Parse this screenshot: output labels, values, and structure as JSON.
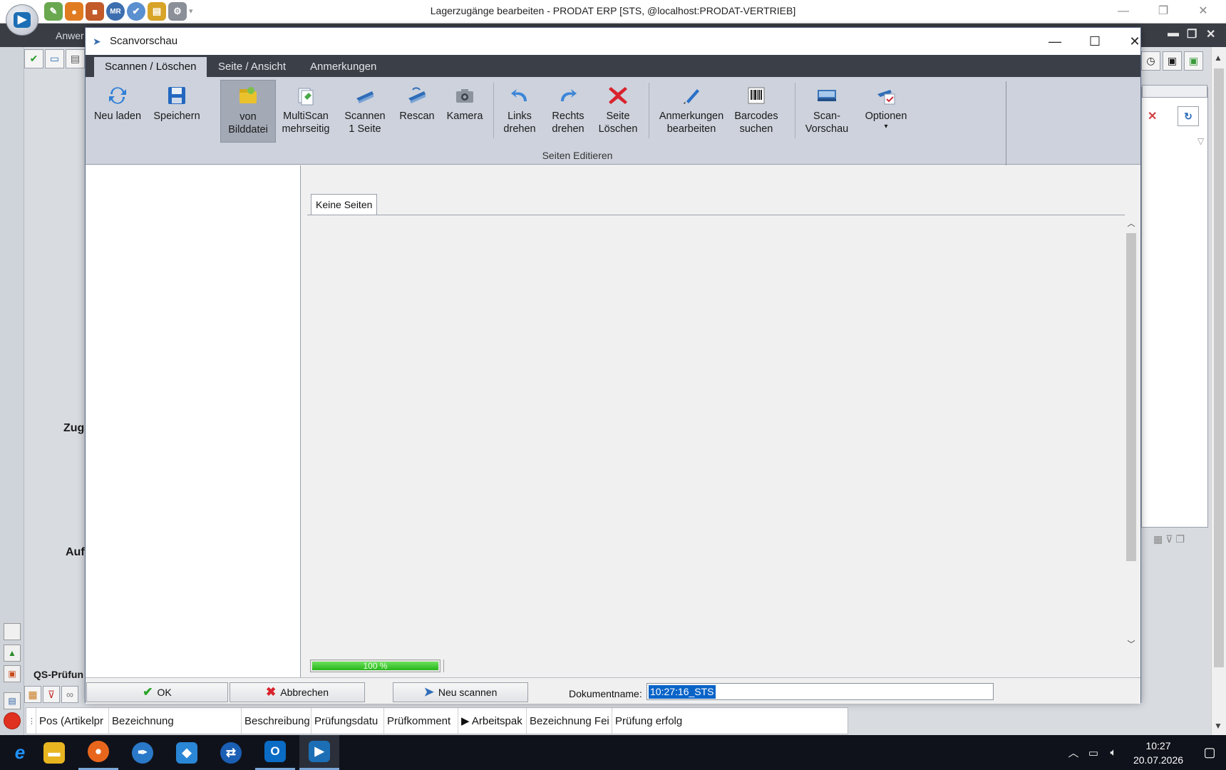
{
  "erp": {
    "window_title": "Lagerzugänge bearbeiten - PRODAT ERP   [STS,  @localhost:PRODAT-VERTRIEB]",
    "logo_glyph": "▶",
    "menu_partial": "Anwer",
    "quick_tools": [
      {
        "icon": "pencil-tool-icon",
        "glyph": "✎",
        "color": "#6aa84f"
      },
      {
        "icon": "orange-tool-icon",
        "glyph": "●",
        "color": "#e07b20"
      },
      {
        "icon": "boxes-tool-icon",
        "glyph": "■",
        "color": "#c25a2a"
      },
      {
        "icon": "mr-badge-icon",
        "glyph": "MR",
        "color": "#3d6fb0"
      },
      {
        "icon": "checkmark-circle-icon",
        "glyph": "✔",
        "color": "#5a8fd0"
      },
      {
        "icon": "book-tool-icon",
        "glyph": "▤",
        "color": "#d8a428"
      },
      {
        "icon": "gears-tool-icon",
        "glyph": "⚙",
        "color": "#8a8f98"
      }
    ],
    "background_labels": {
      "zug": "Zug",
      "auf": "Auf"
    },
    "qs_header": "QS-Prüfun",
    "qs_columns": [
      "Pos (Artikelpr",
      "Bezeichnung",
      "Beschreibung",
      "Prüfungsdatu",
      "Prüfkomment",
      "▶ Arbeitspak",
      "Bezeichnung Fei",
      "Prüfung erfolg"
    ]
  },
  "dialog": {
    "title": "Scanvorschau",
    "tabs": [
      "Scannen / Löschen",
      "Seite / Ansicht",
      "Anmerkungen"
    ],
    "ribbon_buttons": [
      {
        "line1": "Neu laden",
        "line2": "",
        "icon": "refresh-icon"
      },
      {
        "line1": "Speichern",
        "line2": "",
        "icon": "save-disk-icon"
      },
      {
        "line1": "von",
        "line2": "Bilddatei",
        "icon": "image-folder-icon"
      },
      {
        "line1": "MultiScan",
        "line2": "mehrseitig",
        "icon": "multiscan-icon"
      },
      {
        "line1": "Scannen",
        "line2": "1 Seite",
        "icon": "scanner-icon"
      },
      {
        "line1": "Rescan",
        "line2": "",
        "icon": "rescan-icon"
      },
      {
        "line1": "Kamera",
        "line2": "",
        "icon": "camera-icon"
      },
      {
        "line1": "Links",
        "line2": "drehen",
        "icon": "rotate-left-icon"
      },
      {
        "line1": "Rechts",
        "line2": "drehen",
        "icon": "rotate-right-icon"
      },
      {
        "line1": "Seite",
        "line2": "Löschen",
        "icon": "delete-page-icon"
      },
      {
        "line1": "Anmerkungen",
        "line2": "bearbeiten",
        "icon": "pen-icon"
      },
      {
        "line1": "Barcodes",
        "line2": "suchen",
        "icon": "barcode-icon"
      },
      {
        "line1": "Scan-",
        "line2": "Vorschau",
        "icon": "scan-preview-icon"
      },
      {
        "line1": "Optionen",
        "line2": "▾",
        "icon": "options-icon"
      }
    ],
    "group_label": "Seiten Editieren",
    "pages_tab": "Keine Seiten",
    "progress": {
      "value": 1.0,
      "label": "100 %"
    },
    "footer": {
      "ok_label": "OK",
      "cancel_label": "Abbrechen",
      "rescan_label": "Neu scannen",
      "docname_label": "Dokumentname:",
      "docname_value": "10:27:16_STS"
    }
  },
  "taskbar": {
    "apps": [
      {
        "icon": "internet-explorer-icon",
        "glyph": "e",
        "color": "#1e90ff"
      },
      {
        "icon": "file-explorer-icon",
        "glyph": "▬",
        "color": "#e8b520"
      },
      {
        "icon": "firefox-icon",
        "glyph": "●",
        "color": "#e8661c"
      },
      {
        "icon": "feather-app-icon",
        "glyph": "✒",
        "color": "#2a79c9"
      },
      {
        "icon": "vscode-icon",
        "glyph": "◆",
        "color": "#2a86d6"
      },
      {
        "icon": "teamviewer-icon",
        "glyph": "⇄",
        "color": "#1a5fb4"
      },
      {
        "icon": "outlook-icon",
        "glyph": "O",
        "color": "#0a6cc4"
      },
      {
        "icon": "prodat-erp-icon",
        "glyph": "▶",
        "color": "#1c6fb5"
      }
    ],
    "time": "10:27",
    "date": "20.07.2026"
  }
}
